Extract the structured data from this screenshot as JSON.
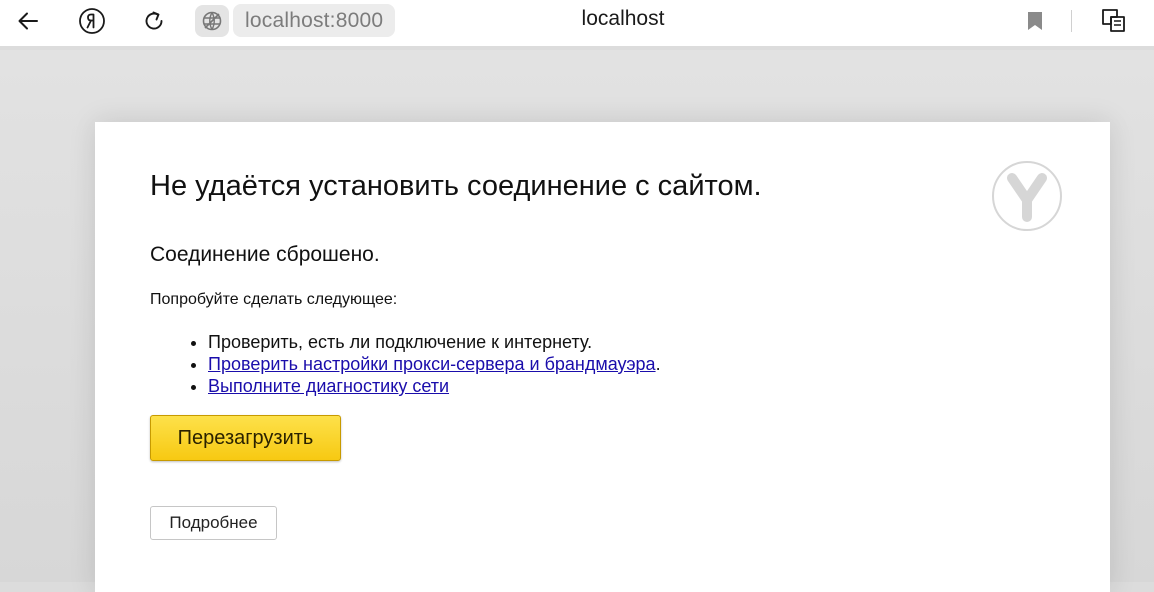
{
  "browser": {
    "address": "localhost:8000",
    "tab_title": "localhost",
    "icons": {
      "back": "back-arrow-icon",
      "yandex": "yandex-logo-icon",
      "reload": "reload-icon",
      "site_info": "globe-icon",
      "bookmark": "bookmark-icon",
      "extensions": "extensions-icon"
    }
  },
  "error_page": {
    "title": "Не удаётся установить соединение с сайтом.",
    "subtitle": "Соединение сброшено.",
    "try_text": "Попробуйте сделать следующее:",
    "suggestions": {
      "check_internet": "Проверить, есть ли подключение к интернету.",
      "proxy_link": "Проверить настройки прокси-сервера и брандмауэра",
      "proxy_suffix": ".",
      "diagnostics_link": "Выполните диагностику сети"
    },
    "reload_button": "Перезагрузить",
    "details_button": "Подробнее",
    "colors": {
      "reload_button": "#fcd432",
      "link": "#1a0dab"
    }
  }
}
